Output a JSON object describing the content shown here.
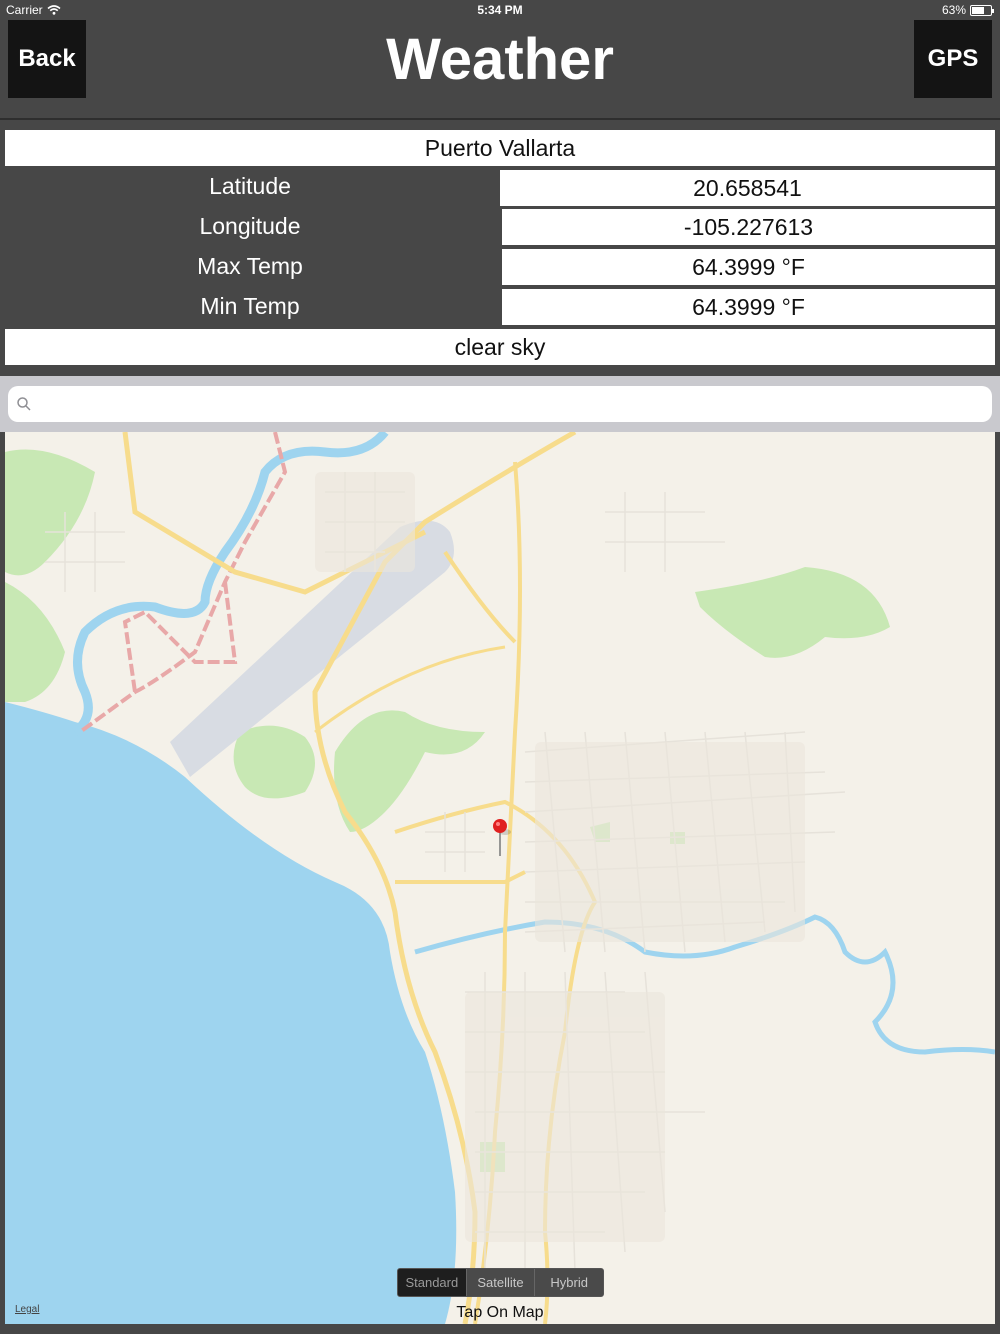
{
  "status_bar": {
    "carrier": "Carrier",
    "time": "5:34 PM",
    "battery": "63%"
  },
  "header": {
    "back_label": "Back",
    "title": "Weather",
    "gps_label": "GPS"
  },
  "info": {
    "city": "Puerto Vallarta",
    "latitude_label": "Latitude",
    "latitude_value": "20.658541",
    "longitude_label": "Longitude",
    "longitude_value": "-105.227613",
    "max_temp_label": "Max Temp",
    "max_temp_value": "64.3999 °F",
    "min_temp_label": "Min Temp",
    "min_temp_value": "64.3999 °F",
    "description": "clear sky"
  },
  "search": {
    "placeholder": ""
  },
  "map": {
    "map_types": [
      "Standard",
      "Satellite",
      "Hybrid"
    ],
    "selected_map_type": "Standard",
    "tap_hint": "Tap On Map",
    "legal": "Legal"
  }
}
